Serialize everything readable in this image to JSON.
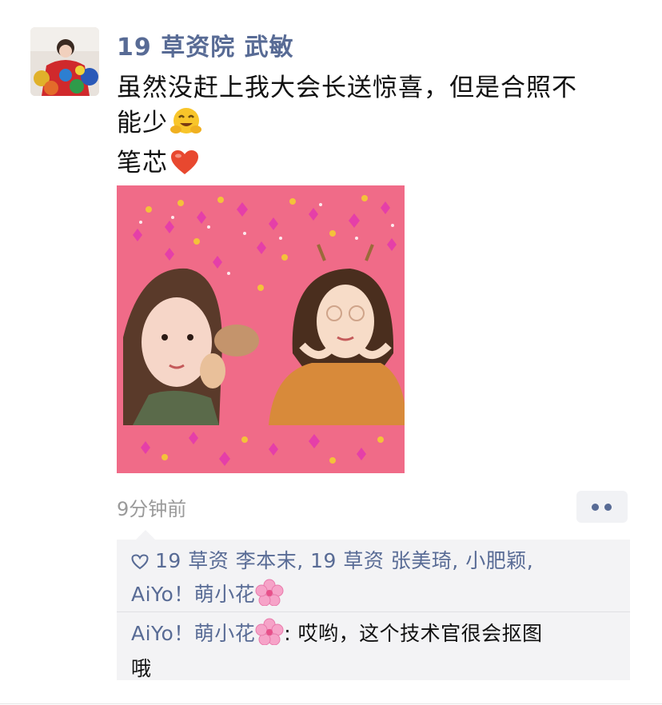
{
  "post": {
    "author": "19 草资院 武敏",
    "text_line1": "虽然没赶上我大会长送惊喜，但是合照不",
    "text_line2": "能少",
    "text_line3": "笔芯",
    "time": "9分钟前"
  },
  "likes": {
    "line1": "19 草资 李本末, 19 草资 张美琦, 小肥颖,",
    "line2": "AiYo！萌小花"
  },
  "comment": {
    "author": "AiYo！萌小花",
    "separator": ":",
    "text_line1": " 哎哟，这个技术官很会抠图",
    "text_line2": "哦"
  },
  "colors": {
    "name_blue": "#586b95",
    "photo_pink": "#f06b88",
    "panel_gray": "#f3f3f5"
  },
  "icons": [
    "hugging-face-emoji",
    "red-heart-emoji",
    "heart-outline-icon",
    "cherry-blossom-emoji",
    "more-dots-icon"
  ]
}
